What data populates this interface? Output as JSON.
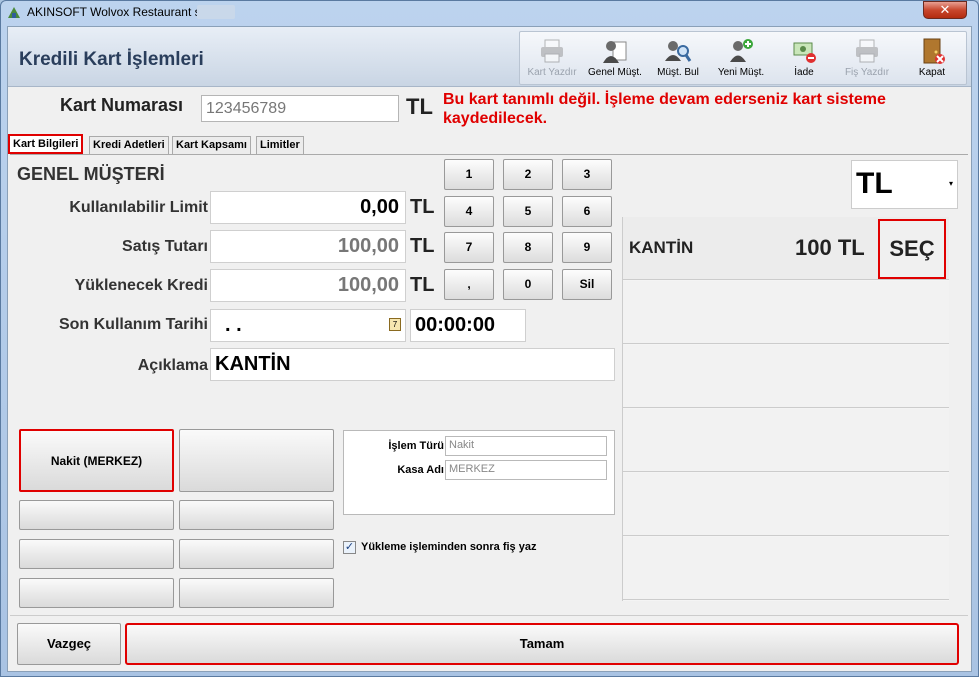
{
  "window": {
    "title": "AKINSOFT Wolvox Restaurant s",
    "close_glyph": "✕"
  },
  "form_title": "Kredili Kart İşlemleri",
  "toolbar": [
    {
      "label": "Kart Yazdır",
      "icon": "printer-icon",
      "enabled": false
    },
    {
      "label": "Genel Müşt.",
      "icon": "user-document-icon",
      "enabled": true
    },
    {
      "label": "Müşt. Bul",
      "icon": "find-users-icon",
      "enabled": true
    },
    {
      "label": "Yeni Müşt.",
      "icon": "add-user-icon",
      "enabled": true
    },
    {
      "label": "İade",
      "icon": "return-money-icon",
      "enabled": true
    },
    {
      "label": "Fiş Yazdır",
      "icon": "printer-icon",
      "enabled": false
    },
    {
      "label": "Kapat",
      "icon": "exit-door-icon",
      "enabled": true
    }
  ],
  "card": {
    "label": "Kart Numarası",
    "value": "123456789",
    "currency": "TL"
  },
  "warning": "Bu kart tanımlı değil. İşleme devam ederseniz kart sisteme kaydedilecek.",
  "tabs": [
    {
      "label": "Kart Bilgileri",
      "active": true
    },
    {
      "label": "Kredi Adetleri",
      "active": false
    },
    {
      "label": "Kart Kapsamı",
      "active": false
    },
    {
      "label": "Limitler",
      "active": false
    }
  ],
  "customer_name": "GENEL MÜŞTERİ",
  "fields": {
    "limit": {
      "label": "Kullanılabilir Limit",
      "value": "0,00",
      "currency": "TL"
    },
    "sale": {
      "label": "Satış Tutarı",
      "value": "100,00",
      "currency": "TL"
    },
    "credit": {
      "label": "Yüklenecek Kredi",
      "value": "100,00",
      "currency": "TL"
    },
    "last_use": {
      "label": "Son Kullanım Tarihi",
      "date": ". .",
      "time": "00:00:00",
      "cal_glyph": "7"
    },
    "note": {
      "label": "Açıklama",
      "value": "KANTİN"
    }
  },
  "keypad": [
    "1",
    "2",
    "3",
    "4",
    "5",
    "6",
    "7",
    "8",
    "9",
    ",",
    "0",
    "Sil"
  ],
  "currency_select": {
    "value": "TL",
    "arrow": "▾"
  },
  "grid_rows": [
    {
      "name": "KANTİN",
      "amount": "100 TL",
      "action": "SEÇ"
    }
  ],
  "payment_buttons": [
    "Nakit (MERKEZ)",
    "",
    "",
    "",
    "",
    "",
    "",
    ""
  ],
  "info": {
    "type_label": "İşlem Türü",
    "type_value": "Nakit",
    "till_label": "Kasa Adı",
    "till_value": "MERKEZ"
  },
  "print_after": {
    "label": "Yükleme işleminden sonra fiş yaz",
    "checked": true,
    "check_glyph": "✓"
  },
  "actions": {
    "cancel": "Vazgeç",
    "ok": "Tamam"
  },
  "colors": {
    "highlight_red": "#e00000",
    "warning_text": "#e00000",
    "title_text": "#2a3e5c"
  }
}
